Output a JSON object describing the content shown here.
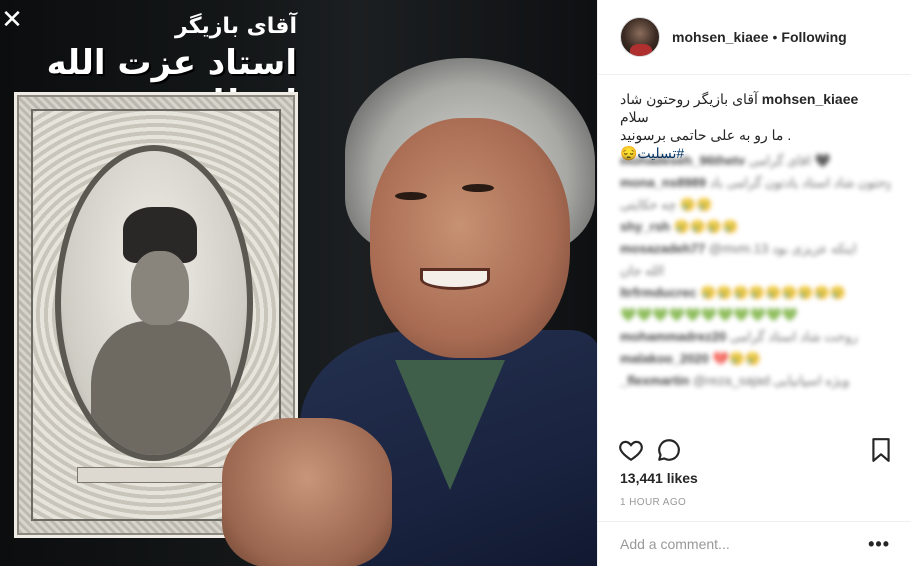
{
  "overlay": {
    "close_icon": "✕"
  },
  "photo": {
    "title_small": "آقای بازیگر",
    "title_big": "استاد عزت الله انتظامی"
  },
  "header": {
    "username": "mohsen_kiaee",
    "separator": "•",
    "follow_status": "Following"
  },
  "caption": {
    "username": "mohsen_kiaee",
    "line1": "آقای بازیگر روحتون شاد سلام",
    "line2": ". ما رو به علی حاتمی برسونید",
    "hashtag": "#تسلیت😔"
  },
  "blurred_comments": [
    {
      "user": "mohadeseh_96thetv",
      "text": "اقای گرامی",
      "emoji": "🖤"
    },
    {
      "user": "mona_ns8989",
      "text": "روحتون شاد استاد یادتون گرامی باد",
      "emoji": ""
    },
    {
      "user": "",
      "text": "چه حکایتی",
      "emoji": "😢😢"
    },
    {
      "user": "shy_rsh",
      "text": "",
      "emoji": "😢😢😢😢"
    },
    {
      "user": "mosazadeh77",
      "text": "@mvm.13 اینکه عزیزی بود",
      "emoji": ""
    },
    {
      "user": "",
      "text": "الله جان",
      "emoji": ""
    },
    {
      "user": "ltrfrmducrec",
      "text": "",
      "emoji": "😢😢😢😢😢😢😢😢😢"
    },
    {
      "user": "",
      "text": "",
      "emoji": "💚💚💚💚💚💚💚💚💚💚💚"
    },
    {
      "user": "mohammadrez20",
      "text": "روحت شاد استاد گرامی",
      "emoji": ""
    },
    {
      "user": "malakoo_2020",
      "text": "",
      "emoji": "💔😢😢"
    },
    {
      "user": "_flexmartin",
      "text": "@reza_sajad ویژه اسپانیایی",
      "emoji": ""
    }
  ],
  "actions": {
    "like_icon": "heart-outline",
    "comment_icon": "speech-bubble",
    "save_icon": "bookmark"
  },
  "stats": {
    "likes": "13,441 likes",
    "time": "1 HOUR AGO"
  },
  "comment_box": {
    "placeholder": "Add a comment...",
    "more": "•••"
  }
}
